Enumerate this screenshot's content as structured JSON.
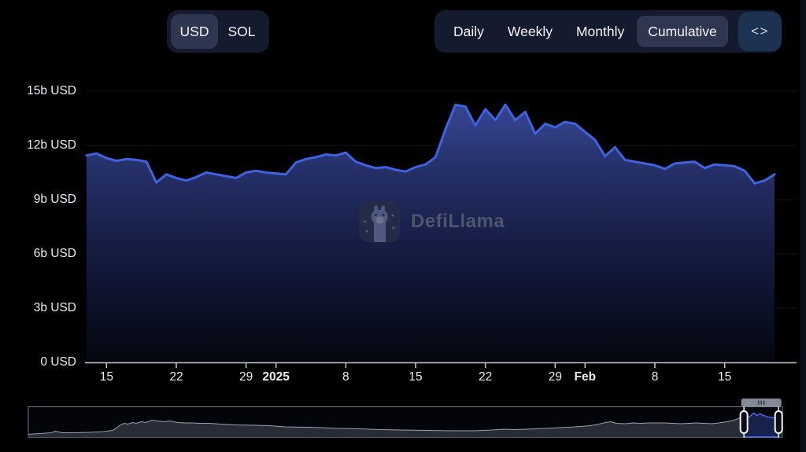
{
  "header": {
    "currency_toggle": {
      "options": [
        {
          "label": "USD",
          "selected": true
        },
        {
          "label": "SOL",
          "selected": false
        }
      ]
    },
    "interval_tabs": {
      "options": [
        {
          "label": "Daily",
          "selected": false
        },
        {
          "label": "Weekly",
          "selected": false
        },
        {
          "label": "Monthly",
          "selected": false
        },
        {
          "label": "Cumulative",
          "selected": true
        }
      ]
    },
    "embed_button": {
      "icon": "embed-code-icon",
      "glyph": "<>"
    }
  },
  "watermark": {
    "text": "DefiLlama",
    "icon": "defillama-llama-logo"
  },
  "colors": {
    "background": "#000000",
    "accent_line": "#3E63E0",
    "control_bg": "#151B2F",
    "selected_pill_bg": "#2F3650",
    "embed_button_bg": "#1D3150",
    "axis_text": "#EDEDF0",
    "watermark_text": "#4D566F",
    "navigator_line": "#9AA1AB",
    "navigator_fill": "#272C37"
  },
  "chart_data": {
    "type": "area",
    "series_name": "Cumulative (USD)",
    "y_unit": "b USD",
    "ylim": [
      0,
      15
    ],
    "grid": "horizontal",
    "legend": "none",
    "x": [
      "2024-12-13",
      "2024-12-14",
      "2024-12-15",
      "2024-12-16",
      "2024-12-17",
      "2024-12-18",
      "2024-12-19",
      "2024-12-20",
      "2024-12-21",
      "2024-12-22",
      "2024-12-23",
      "2024-12-24",
      "2024-12-25",
      "2024-12-26",
      "2024-12-27",
      "2024-12-28",
      "2024-12-29",
      "2024-12-30",
      "2024-12-31",
      "2025-01-01",
      "2025-01-02",
      "2025-01-03",
      "2025-01-04",
      "2025-01-05",
      "2025-01-06",
      "2025-01-07",
      "2025-01-08",
      "2025-01-09",
      "2025-01-10",
      "2025-01-11",
      "2025-01-12",
      "2025-01-13",
      "2025-01-14",
      "2025-01-15",
      "2025-01-16",
      "2025-01-17",
      "2025-01-18",
      "2025-01-19",
      "2025-01-20",
      "2025-01-21",
      "2025-01-22",
      "2025-01-23",
      "2025-01-24",
      "2025-01-25",
      "2025-01-26",
      "2025-01-27",
      "2025-01-28",
      "2025-01-29",
      "2025-01-30",
      "2025-01-31",
      "2025-02-01",
      "2025-02-02",
      "2025-02-03",
      "2025-02-04",
      "2025-02-05",
      "2025-02-06",
      "2025-02-07",
      "2025-02-08",
      "2025-02-09",
      "2025-02-10",
      "2025-02-11",
      "2025-02-12",
      "2025-02-13",
      "2025-02-14",
      "2025-02-15",
      "2025-02-16",
      "2025-02-17",
      "2025-02-18",
      "2025-02-19",
      "2025-02-20"
    ],
    "values": [
      11.45,
      11.55,
      11.3,
      11.15,
      11.25,
      11.2,
      11.1,
      9.95,
      10.4,
      10.2,
      10.05,
      10.25,
      10.5,
      10.4,
      10.3,
      10.2,
      10.5,
      10.6,
      10.5,
      10.45,
      10.4,
      11.05,
      11.25,
      11.35,
      11.5,
      11.45,
      11.6,
      11.1,
      10.9,
      10.75,
      10.8,
      10.65,
      10.55,
      10.8,
      10.95,
      11.35,
      12.9,
      14.25,
      14.15,
      13.1,
      14.0,
      13.4,
      14.25,
      13.4,
      13.85,
      12.65,
      13.2,
      13.0,
      13.3,
      13.2,
      12.75,
      12.3,
      11.4,
      11.9,
      11.2,
      11.1,
      11.0,
      10.9,
      10.7,
      11.0,
      11.05,
      11.1,
      10.75,
      10.95,
      10.9,
      10.85,
      10.6,
      9.9,
      10.05,
      10.4
    ],
    "y_ticks": [
      {
        "value": 0,
        "label": "0 USD"
      },
      {
        "value": 3,
        "label": "3b USD"
      },
      {
        "value": 6,
        "label": "6b USD"
      },
      {
        "value": 9,
        "label": "9b USD"
      },
      {
        "value": 12,
        "label": "12b USD"
      },
      {
        "value": 15,
        "label": "15b USD"
      }
    ],
    "x_ticks": [
      {
        "index": 2,
        "label": "15"
      },
      {
        "index": 9,
        "label": "22"
      },
      {
        "index": 16,
        "label": "29"
      },
      {
        "index": 19,
        "label": "2025",
        "bold": true
      },
      {
        "index": 26,
        "label": "8"
      },
      {
        "index": 33,
        "label": "15"
      },
      {
        "index": 40,
        "label": "22"
      },
      {
        "index": 47,
        "label": "29"
      },
      {
        "index": 50,
        "label": "Feb",
        "bold": true
      },
      {
        "index": 57,
        "label": "8"
      },
      {
        "index": 64,
        "label": "15"
      }
    ]
  },
  "navigator": {
    "description": "full-history mini preview with zoom window on most recent period",
    "selection": {
      "start_frac": 0.949,
      "end_frac": 0.995
    },
    "points": [
      [
        0,
        4
      ],
      [
        0.015,
        5
      ],
      [
        0.03,
        6
      ],
      [
        0.036,
        8
      ],
      [
        0.045,
        6
      ],
      [
        0.06,
        6
      ],
      [
        0.08,
        6.5
      ],
      [
        0.1,
        7.5
      ],
      [
        0.112,
        9
      ],
      [
        0.118,
        13
      ],
      [
        0.122,
        16
      ],
      [
        0.127,
        18
      ],
      [
        0.132,
        17
      ],
      [
        0.138,
        19
      ],
      [
        0.143,
        18
      ],
      [
        0.15,
        20
      ],
      [
        0.156,
        19
      ],
      [
        0.164,
        22
      ],
      [
        0.171,
        21
      ],
      [
        0.18,
        20
      ],
      [
        0.188,
        21
      ],
      [
        0.198,
        19
      ],
      [
        0.208,
        18.5
      ],
      [
        0.218,
        18.5
      ],
      [
        0.228,
        18
      ],
      [
        0.24,
        18
      ],
      [
        0.255,
        17
      ],
      [
        0.275,
        16
      ],
      [
        0.3,
        15.5
      ],
      [
        0.32,
        15
      ],
      [
        0.34,
        13.5
      ],
      [
        0.37,
        13
      ],
      [
        0.39,
        12.5
      ],
      [
        0.41,
        11.5
      ],
      [
        0.44,
        11
      ],
      [
        0.465,
        10
      ],
      [
        0.495,
        9.5
      ],
      [
        0.53,
        9
      ],
      [
        0.56,
        8.5
      ],
      [
        0.59,
        8.5
      ],
      [
        0.615,
        9.5
      ],
      [
        0.63,
        10.5
      ],
      [
        0.645,
        10
      ],
      [
        0.66,
        10.5
      ],
      [
        0.685,
        11.5
      ],
      [
        0.705,
        12.5
      ],
      [
        0.725,
        13.5
      ],
      [
        0.745,
        15
      ],
      [
        0.757,
        17
      ],
      [
        0.765,
        19
      ],
      [
        0.772,
        20
      ],
      [
        0.78,
        18
      ],
      [
        0.792,
        17.5
      ],
      [
        0.802,
        18.5
      ],
      [
        0.812,
        18
      ],
      [
        0.823,
        18.5
      ],
      [
        0.835,
        18.5
      ],
      [
        0.845,
        18.5
      ],
      [
        0.855,
        18
      ],
      [
        0.865,
        17.5
      ],
      [
        0.876,
        18
      ],
      [
        0.886,
        18.5
      ],
      [
        0.896,
        18
      ],
      [
        0.906,
        17.5
      ],
      [
        0.916,
        18.5
      ],
      [
        0.926,
        20
      ],
      [
        0.936,
        22
      ],
      [
        0.944,
        25
      ],
      [
        0.95,
        27
      ],
      [
        0.956,
        26
      ],
      [
        0.962,
        31
      ],
      [
        0.966,
        28
      ],
      [
        0.97,
        30
      ],
      [
        0.975,
        28
      ],
      [
        0.981,
        26
      ],
      [
        0.988,
        25
      ],
      [
        0.995,
        27
      ],
      [
        1,
        28
      ]
    ]
  }
}
